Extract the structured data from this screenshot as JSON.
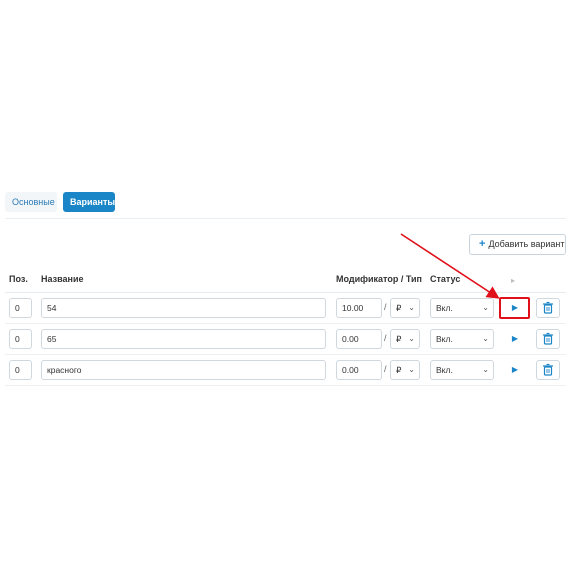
{
  "tabs": [
    {
      "label": "Основные"
    },
    {
      "label": "Варианты"
    }
  ],
  "toolbar": {
    "add_variant_label": "Добавить вариант"
  },
  "table": {
    "headers": {
      "position": "Поз.",
      "name": "Название",
      "modifier_type": "Модификатор / Тип",
      "status": "Статус"
    },
    "separator": "/",
    "rows": [
      {
        "position": "0",
        "name": "54",
        "modifier": "10.00",
        "type": "₽",
        "status": "Вкл."
      },
      {
        "position": "0",
        "name": "65",
        "modifier": "0.00",
        "type": "₽",
        "status": "Вкл."
      },
      {
        "position": "0",
        "name": "красного",
        "modifier": "0.00",
        "type": "₽",
        "status": "Вкл."
      }
    ]
  },
  "colors": {
    "accent": "#1b86c7",
    "annotation": "#e0101a"
  },
  "icons": {
    "add": "plus-icon",
    "expand": "caret-right-icon",
    "delete": "trash-icon",
    "dropdown": "chevron-down-icon"
  }
}
